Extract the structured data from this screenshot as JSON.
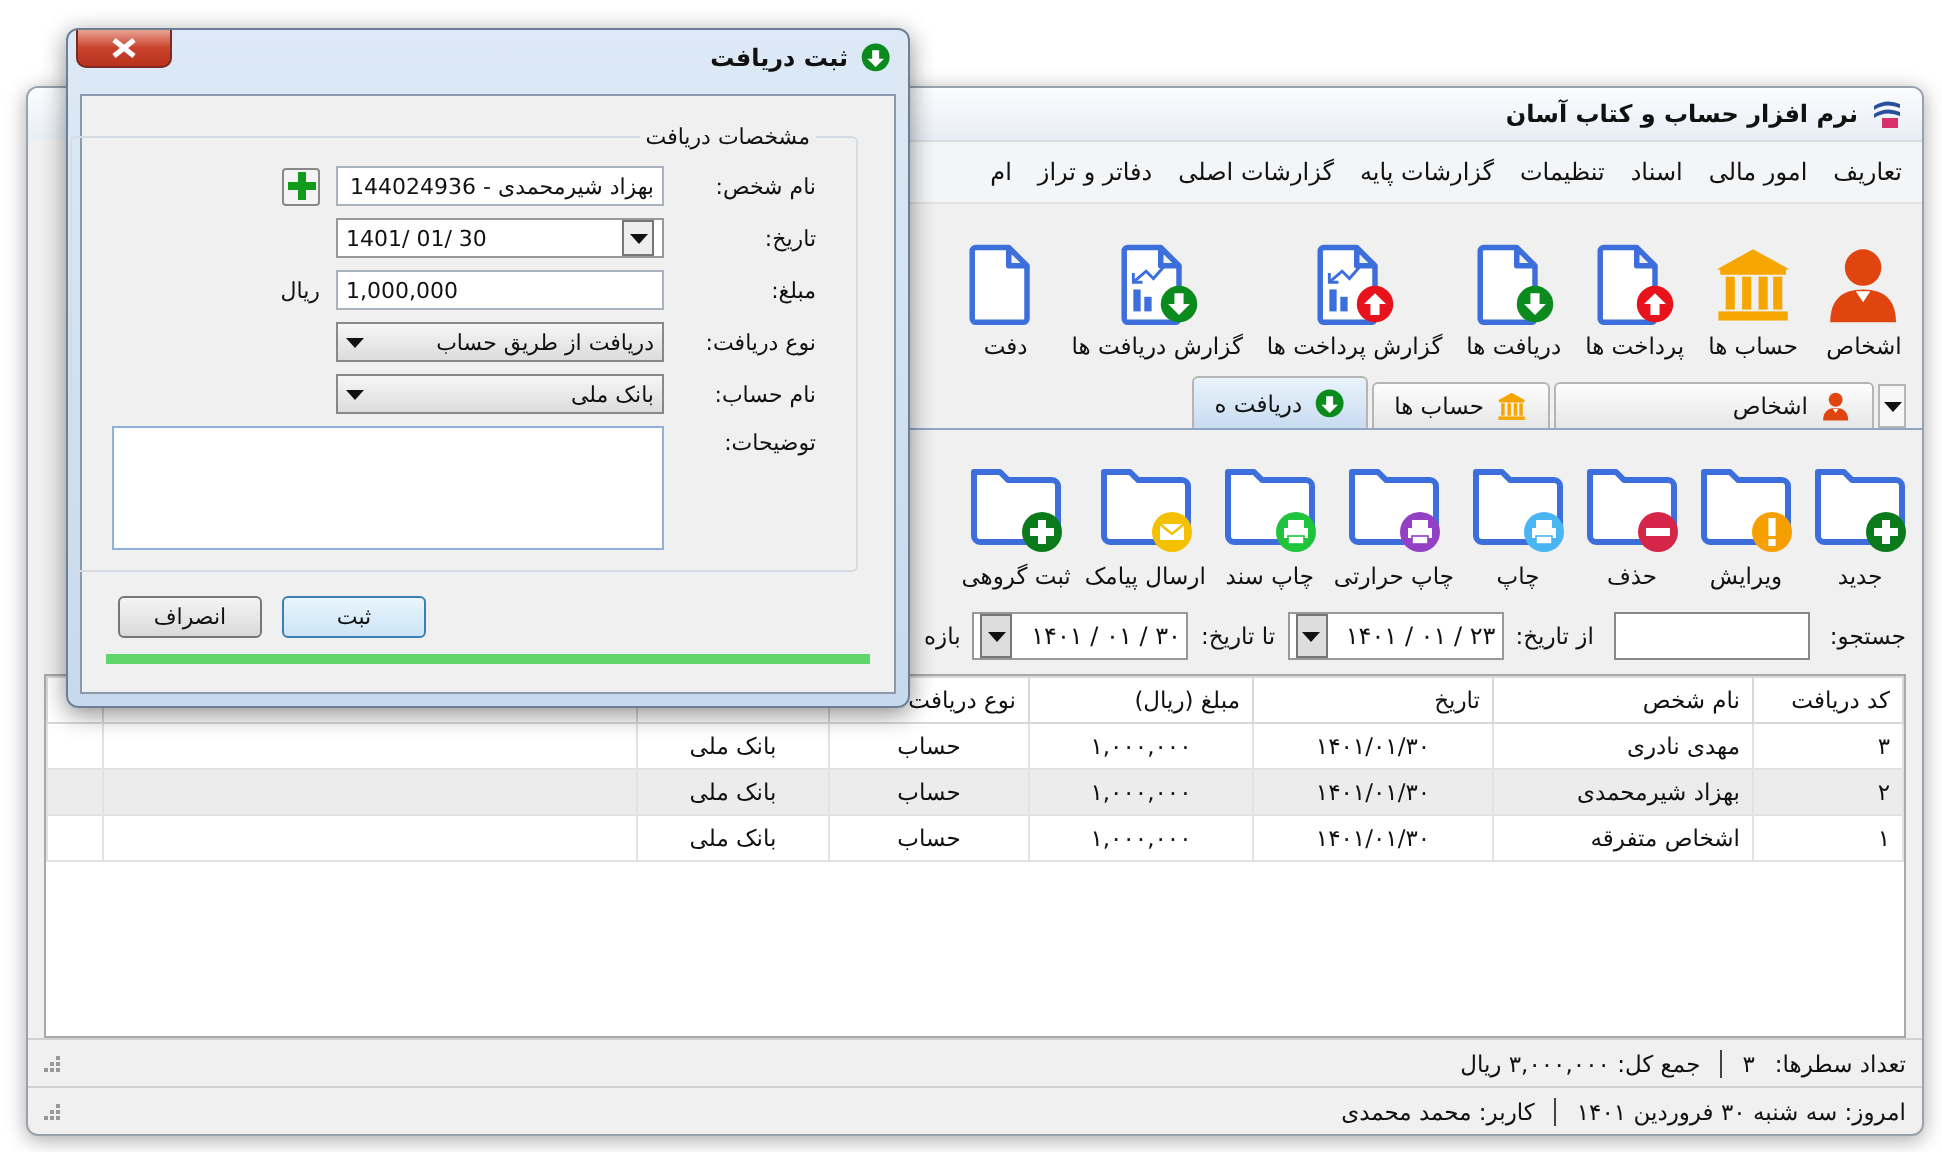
{
  "window": {
    "title": "نرم افزار حساب و کتاب آسان"
  },
  "menu": [
    "تعاریف",
    "امور مالی",
    "اسناد",
    "تنظیمات",
    "گزارشات پایه",
    "گزارشات اصلی",
    "دفاتر و تراز",
    "ام"
  ],
  "ribbon": [
    {
      "kind": "person",
      "label": "اشخاص"
    },
    {
      "kind": "bank",
      "label": "حساب ها"
    },
    {
      "kind": "doc-up",
      "label": "پرداخت ها"
    },
    {
      "kind": "doc-down",
      "label": "دریافت ها"
    },
    {
      "kind": "report-up",
      "label": "گزارش پرداخت ها"
    },
    {
      "kind": "report-down",
      "label": "گزارش دریافت ها"
    },
    {
      "kind": "doc",
      "label": "دفت"
    }
  ],
  "tabs": [
    {
      "kind": "person",
      "label": "اشخاص",
      "selected": false
    },
    {
      "kind": "bank",
      "label": "حساب ها",
      "selected": false
    },
    {
      "kind": "down",
      "label": "دریافت ه",
      "selected": true
    }
  ],
  "actions": [
    {
      "kind": "add",
      "label": "جدید"
    },
    {
      "kind": "edit",
      "label": "ویرایش"
    },
    {
      "kind": "delete",
      "label": "حذف"
    },
    {
      "kind": "print",
      "label": "چاپ"
    },
    {
      "kind": "print-thermal",
      "label": "چاپ حرارتی"
    },
    {
      "kind": "print-doc",
      "label": "چاپ سند"
    },
    {
      "kind": "sms",
      "label": "ارسال پیامک"
    },
    {
      "kind": "add",
      "label": "ثبت گروهی"
    }
  ],
  "filter": {
    "search_label": "جستجو:",
    "from_label": "از تاریخ:",
    "from_value": "۱۴۰۱ / ۰۱ / ۲۳",
    "to_label": "تا تاریخ:",
    "to_value": "۱۴۰۱ / ۰۱ / ۳۰",
    "range_label": "بازه"
  },
  "table": {
    "columns": [
      "کد دریافت",
      "نام شخص",
      "تاریخ",
      "مبلغ (ریال)",
      "نوع دریافت"
    ],
    "rows": [
      {
        "cells": [
          "۳",
          "مهدی نادری",
          "۱۴۰۱/۰۱/۳۰",
          "۱,۰۰۰,۰۰۰",
          "حساب",
          "بانک ملی"
        ],
        "selected": false
      },
      {
        "cells": [
          "۲",
          "بهزاد شیرمحمدی",
          "۱۴۰۱/۰۱/۳۰",
          "۱,۰۰۰,۰۰۰",
          "حساب",
          "بانک ملی"
        ],
        "selected": true
      },
      {
        "cells": [
          "۱",
          "اشخاص متفرقه",
          "۱۴۰۱/۰۱/۳۰",
          "۱,۰۰۰,۰۰۰",
          "حساب",
          "بانک ملی"
        ],
        "selected": false
      }
    ]
  },
  "status": {
    "row_count_label": "تعداد سطرها:",
    "row_count": "۳",
    "total": "جمع کل: ۳,۰۰۰,۰۰۰ ریال",
    "today": "امروز: سه شنبه ۳۰ فروردین ۱۴۰۱",
    "user": "کاربر: محمد محمدی"
  },
  "dialog": {
    "title": "ثبت دریافت",
    "group_title": "مشخصات دریافت",
    "fields": [
      {
        "kind": "combo",
        "label": "نام شخص:",
        "value": "بهزاد شیرمحمدی - 144024936"
      },
      {
        "kind": "date",
        "label": "تاریخ:",
        "value": "1401/ 01/ 30"
      },
      {
        "kind": "amount",
        "label": "مبلغ:",
        "value": "1,000,000",
        "unit": "ریال"
      },
      {
        "kind": "dropdown",
        "label": "نوع دریافت:",
        "value": "دریافت از طریق حساب"
      },
      {
        "kind": "dropdown",
        "label": "نام حساب:",
        "value": "بانک ملی"
      },
      {
        "kind": "notes",
        "label": "توضیحات:"
      }
    ],
    "buttons": [
      {
        "label": "ثبت",
        "default": true
      },
      {
        "label": "انصراف",
        "default": false
      }
    ],
    "progress": {
      "level": 1
    }
  }
}
